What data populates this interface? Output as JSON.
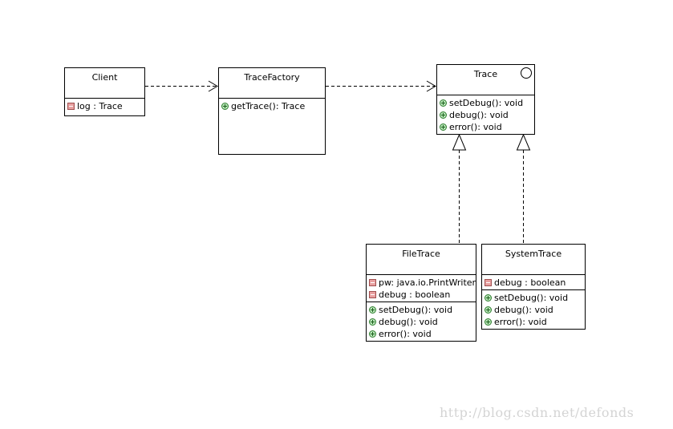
{
  "diagram": {
    "type": "UML class diagram",
    "classes": {
      "client": {
        "name": "Client",
        "attributes": [
          {
            "visibility": "private",
            "text": "log : Trace"
          }
        ],
        "operations": []
      },
      "tracefactory": {
        "name": "TraceFactory",
        "attributes": [],
        "operations": [
          {
            "visibility": "public",
            "text": "getTrace(): Trace"
          }
        ]
      },
      "trace": {
        "name": "Trace",
        "stereotype_icon": "interface-circle-icon",
        "attributes": [],
        "operations": [
          {
            "visibility": "public",
            "text": "setDebug(): void"
          },
          {
            "visibility": "public",
            "text": "debug(): void"
          },
          {
            "visibility": "public",
            "text": "error(): void"
          }
        ]
      },
      "filetrace": {
        "name": "FileTrace",
        "attributes": [
          {
            "visibility": "private",
            "text": "pw: java.io.PrintWriter"
          },
          {
            "visibility": "private",
            "text": "debug : boolean"
          }
        ],
        "operations": [
          {
            "visibility": "public",
            "text": "setDebug(): void"
          },
          {
            "visibility": "public",
            "text": "debug(): void"
          },
          {
            "visibility": "public",
            "text": "error(): void"
          }
        ]
      },
      "systemtrace": {
        "name": "SystemTrace",
        "attributes": [
          {
            "visibility": "private",
            "text": "debug : boolean"
          }
        ],
        "operations": [
          {
            "visibility": "public",
            "text": "setDebug(): void"
          },
          {
            "visibility": "public",
            "text": "debug(): void"
          },
          {
            "visibility": "public",
            "text": "error(): void"
          }
        ]
      }
    },
    "relationships": [
      {
        "type": "dependency",
        "from": "Client",
        "to": "TraceFactory"
      },
      {
        "type": "dependency",
        "from": "TraceFactory",
        "to": "Trace"
      },
      {
        "type": "realization",
        "from": "FileTrace",
        "to": "Trace"
      },
      {
        "type": "realization",
        "from": "SystemTrace",
        "to": "Trace"
      }
    ],
    "colors": {
      "private_marker": "#e8a0a0",
      "public_marker": "#b8e6b8",
      "line": "#000000"
    }
  },
  "watermark": "http://blog.csdn.net/defonds"
}
